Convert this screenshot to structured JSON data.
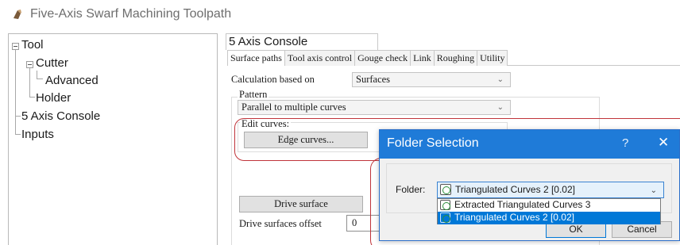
{
  "window": {
    "title": "Five-Axis Swarf Machining Toolpath",
    "icon": "toolpath-icon"
  },
  "tree": {
    "items": [
      {
        "label": "Tool",
        "expanded": true
      },
      {
        "label": "Cutter",
        "expanded": true
      },
      {
        "label": "Advanced"
      },
      {
        "label": "Holder"
      },
      {
        "label": "5 Axis Console"
      },
      {
        "label": "Inputs"
      }
    ]
  },
  "console": {
    "tab_title": "5 Axis Console",
    "subtabs": [
      "Surface paths",
      "Tool axis control",
      "Gouge check",
      "Link",
      "Roughing",
      "Utility"
    ],
    "active_subtab": "Surface paths",
    "calc_label": "Calculation based on",
    "calc_value": "Surfaces",
    "pattern_label": "Pattern",
    "pattern_value": "Parallel to multiple curves",
    "edit_curves_label": "Edit curves:",
    "edge_curves_button": "Edge curves...",
    "drive_surface_button": "Drive surface",
    "drive_offset_label": "Drive surfaces offset",
    "drive_offset_value": "0"
  },
  "dialog": {
    "title": "Folder Selection",
    "help_glyph": "?",
    "close_glyph": "✕",
    "folder_label": "Folder:",
    "folder_value": "Triangulated Curves 2 [0.02]",
    "options": [
      "Extracted Triangulated Curves 3",
      "Triangulated Curves 2 [0.02]"
    ],
    "selected_option": "Triangulated Curves 2 [0.02]",
    "ok_label": "OK",
    "cancel_label": "Cancel"
  },
  "colors": {
    "dialog_title_bg": "#1f7bd8",
    "highlight_outline": "#c0343a",
    "selection": "#0078d7"
  }
}
